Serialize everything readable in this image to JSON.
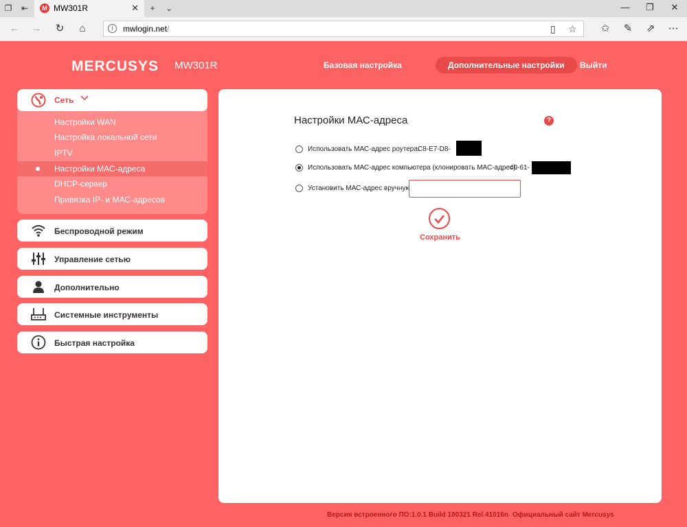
{
  "browser": {
    "tab_title": "MW301R",
    "tab_favicon_letter": "M",
    "url_host": "mwlogin.net",
    "url_path": "/"
  },
  "header": {
    "logo": "MERCUSYS",
    "model": "MW301R",
    "nav": [
      "Базовая настройка",
      "Дополнительные настройки",
      "Выйти"
    ],
    "active_nav": "Дополнительные настройки"
  },
  "sidebar": {
    "network": {
      "label": "Сеть",
      "items": [
        "Настройки WAN",
        "Настройка локальной сети",
        "IPTV",
        "Настройки МАС-адреса",
        "DHCP-сервер",
        "Привязка IP- и МАС-адресов"
      ],
      "active_item": "Настройки МАС-адреса"
    },
    "menus": [
      {
        "label": "Беспроводной режим",
        "icon": "wifi-icon"
      },
      {
        "label": "Управление сетью",
        "icon": "sliders-icon"
      },
      {
        "label": "Дополнительно",
        "icon": "user-icon"
      },
      {
        "label": "Системные инструменты",
        "icon": "router-icon"
      },
      {
        "label": "Быстрая настройка",
        "icon": "info-icon"
      }
    ]
  },
  "main": {
    "title": "Настройки МАС-адреса",
    "help_glyph": "?",
    "options": [
      {
        "label": "Использовать МАС-адрес роутера:",
        "value": "C8-E7-D8-",
        "checked": false
      },
      {
        "label": "Использовать МАС-адрес компьютера (клонировать МАС-адрес):",
        "value": "40-61-",
        "checked": true
      },
      {
        "label": "Установить МАС-адрес вручную:",
        "value": "",
        "checked": false
      }
    ],
    "manual_input_value": "",
    "save_label": "Сохранить"
  },
  "footer": {
    "firmware": "Версия встроенного ПО:1.0.1 Build 180321 Rel.41016n",
    "site_link": "Официальный сайт Mercusys"
  },
  "colors": {
    "brand": "#ff6262",
    "accent": "#e84a4a",
    "submenu_bg": "#ff8a8a",
    "footer_text": "#b31b1b"
  }
}
